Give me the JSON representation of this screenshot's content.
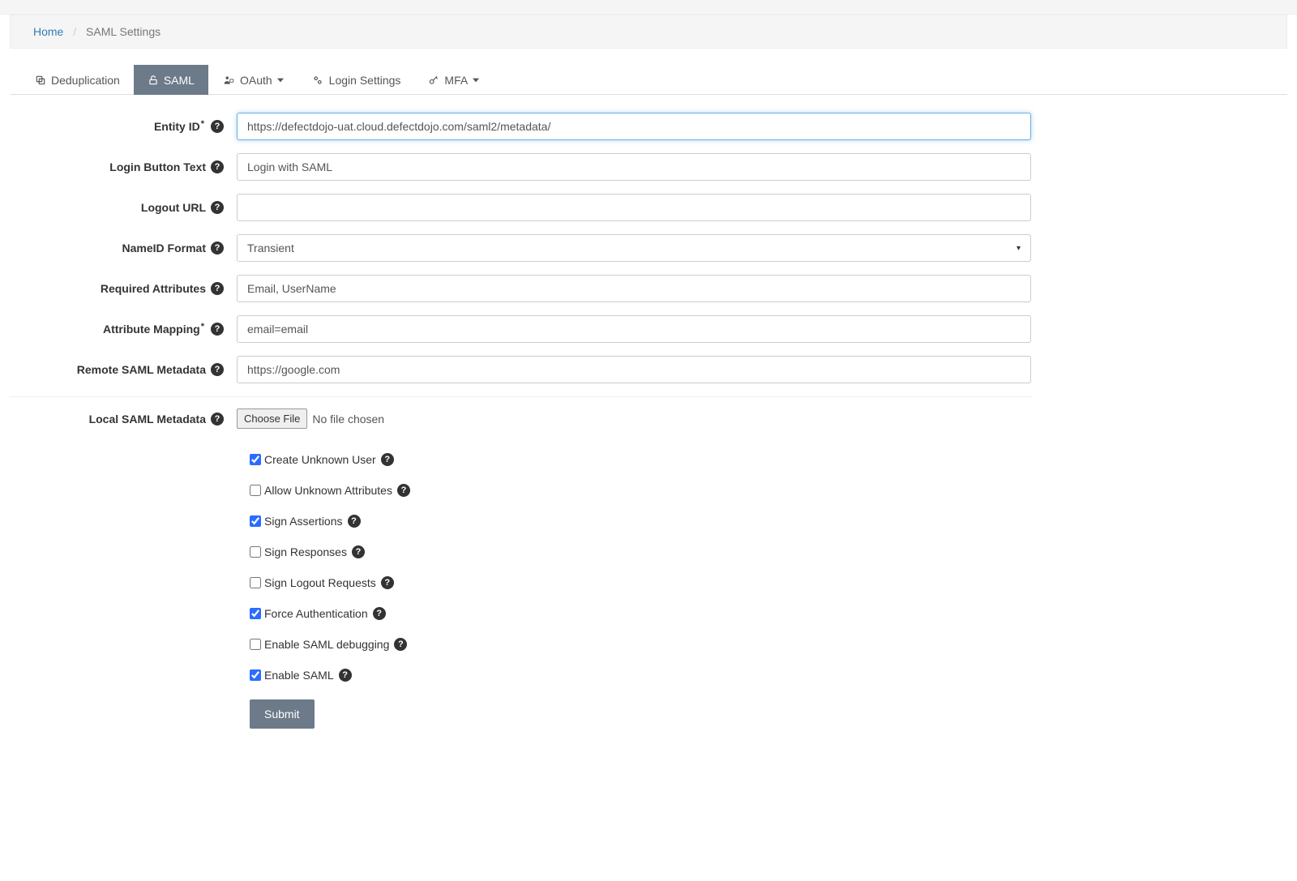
{
  "breadcrumb": {
    "home": "Home",
    "current": "SAML Settings"
  },
  "tabs": {
    "deduplication": "Deduplication",
    "saml": "SAML",
    "oauth": "OAuth",
    "login_settings": "Login Settings",
    "mfa": "MFA"
  },
  "labels": {
    "entity_id": "Entity ID",
    "login_button": "Login Button Text",
    "logout_url": "Logout URL",
    "nameid": "NameID Format",
    "required_attrs": "Required Attributes",
    "attr_mapping": "Attribute Mapping",
    "remote_metadata": "Remote SAML Metadata",
    "local_metadata": "Local SAML Metadata"
  },
  "values": {
    "entity_id": "https://defectdojo-uat.cloud.defectdojo.com/saml2/metadata/",
    "login_button": "Login with SAML",
    "logout_url": "",
    "nameid": "Transient",
    "required_attrs": "Email, UserName",
    "attr_mapping": "email=email",
    "remote_metadata": "https://google.com"
  },
  "file": {
    "choose": "Choose File",
    "none": "No file chosen"
  },
  "checks": {
    "create_unknown_user": {
      "label": "Create Unknown User",
      "checked": true
    },
    "allow_unknown_attrs": {
      "label": "Allow Unknown Attributes",
      "checked": false
    },
    "sign_assertions": {
      "label": "Sign Assertions",
      "checked": true
    },
    "sign_responses": {
      "label": "Sign Responses",
      "checked": false
    },
    "sign_logout": {
      "label": "Sign Logout Requests",
      "checked": false
    },
    "force_auth": {
      "label": "Force Authentication",
      "checked": true
    },
    "enable_debug": {
      "label": "Enable SAML debugging",
      "checked": false
    },
    "enable_saml": {
      "label": "Enable SAML",
      "checked": true
    }
  },
  "submit": "Submit",
  "help_glyph": "?",
  "req_glyph": "*"
}
